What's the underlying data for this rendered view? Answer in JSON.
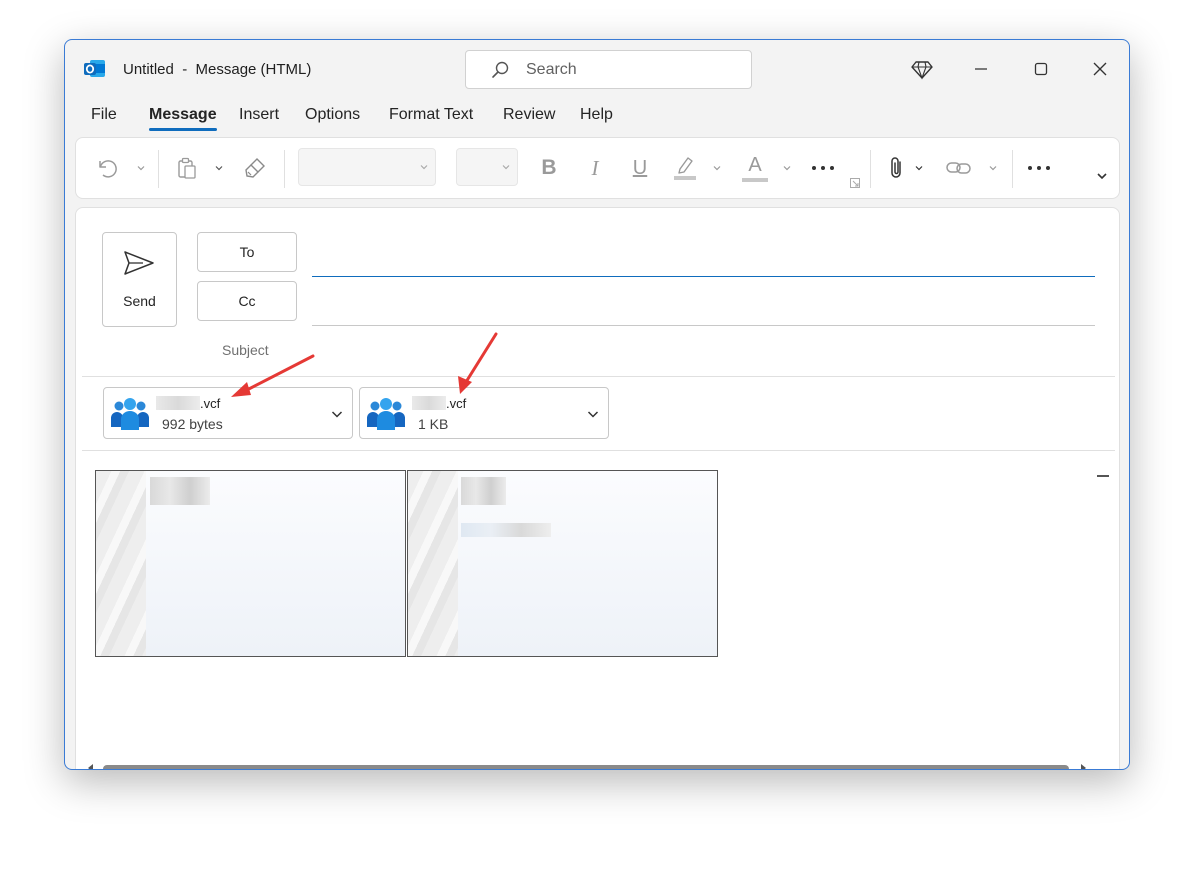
{
  "window": {
    "title": "Untitled  -  Message (HTML)",
    "search_placeholder": "Search",
    "accent": "#0f6cbd"
  },
  "menu": {
    "tabs": [
      {
        "label": "File"
      },
      {
        "label": "Message"
      },
      {
        "label": "Insert"
      },
      {
        "label": "Options"
      },
      {
        "label": "Format Text"
      },
      {
        "label": "Review"
      },
      {
        "label": "Help"
      }
    ],
    "active": "Message"
  },
  "ribbon": {
    "icons": [
      "undo-icon",
      "paste-icon",
      "format-painter-icon",
      "bold-icon",
      "italic-icon",
      "underline-icon",
      "highlight-icon",
      "font-color-icon",
      "more-icon",
      "attach-file-icon",
      "link-icon",
      "more-icon",
      "expand-icon"
    ],
    "bold": "B",
    "italic": "I",
    "underline": "U",
    "font_color_letter": "A"
  },
  "compose": {
    "send_label": "Send",
    "to_label": "To",
    "cc_label": "Cc",
    "subject_label": "Subject"
  },
  "attachments": [
    {
      "name": ".vcf",
      "size": "992 bytes",
      "icon": "contacts-icon"
    },
    {
      "name": ".vcf",
      "size": "1 KB",
      "icon": "contacts-icon"
    }
  ],
  "annotation_color": "#e53935"
}
